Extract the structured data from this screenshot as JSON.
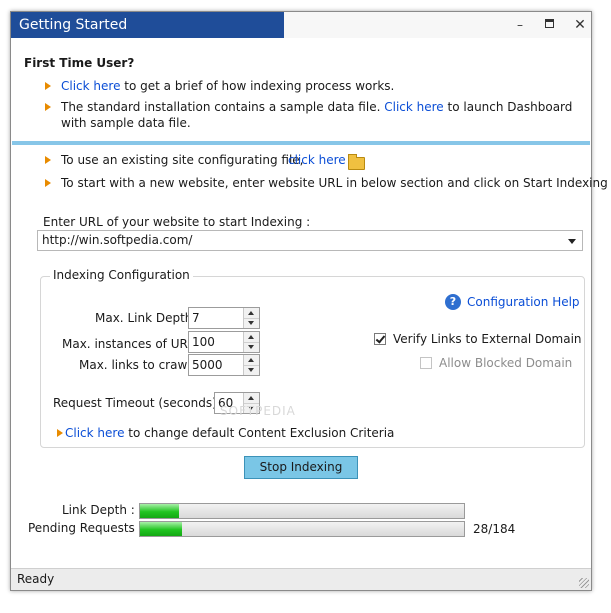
{
  "window": {
    "title": "Getting Started",
    "controls": {
      "minimize": "–",
      "maximize": "",
      "close": "✕"
    }
  },
  "first_time": {
    "heading": "First Time User?",
    "item1": {
      "link": "Click here",
      "text": "to get a brief of how indexing process works."
    },
    "item2": {
      "text_before": "The standard installation contains a sample data file.",
      "link": "Click here",
      "text_after": "to launch Dashboard",
      "text_line2": "with sample data file."
    }
  },
  "site_options": {
    "existing": {
      "text": "To use an existing site configurating file,",
      "link": "click here",
      "icon": "folder-open-icon"
    },
    "new": {
      "text": "To start with a new website, enter website URL in below section and click on Start Indexing"
    }
  },
  "url": {
    "label": "Enter URL of your website to start Indexing :",
    "value": "http://win.softpedia.com/"
  },
  "config": {
    "title": "Indexing Configuration",
    "help_link": "Configuration Help",
    "max_link_depth": {
      "label": "Max. Link Depth:",
      "value": "7"
    },
    "max_instances": {
      "label": "Max. instances of URL:",
      "value": "100"
    },
    "max_links": {
      "label": "Max. links to crawl:",
      "value": "5000"
    },
    "request_timeout": {
      "label": "Request Timeout (seconds):",
      "value": "60"
    },
    "verify_links": {
      "label": "Verify Links to External Domain",
      "checked": true
    },
    "allow_blocked": {
      "label": "Allow Blocked Domain",
      "checked": false,
      "enabled": false
    },
    "exclusion": {
      "link": "Click here",
      "text": "to change default Content Exclusion Criteria"
    },
    "watermark": "SOFTPEDIA"
  },
  "actions": {
    "stop_label": "Stop Indexing"
  },
  "progress": {
    "link_depth": {
      "label": "Link Depth :",
      "fraction": 0.12
    },
    "pending": {
      "label": "Pending Requests :",
      "fraction": 0.13,
      "count": "28/184"
    }
  },
  "status": {
    "text": "Ready"
  },
  "colors": {
    "title_bar": "#1f4d99",
    "link": "#0b4ed6",
    "accent_bar": "#87c6e8",
    "progress": "#21c521",
    "button": "#7ac6e6"
  }
}
